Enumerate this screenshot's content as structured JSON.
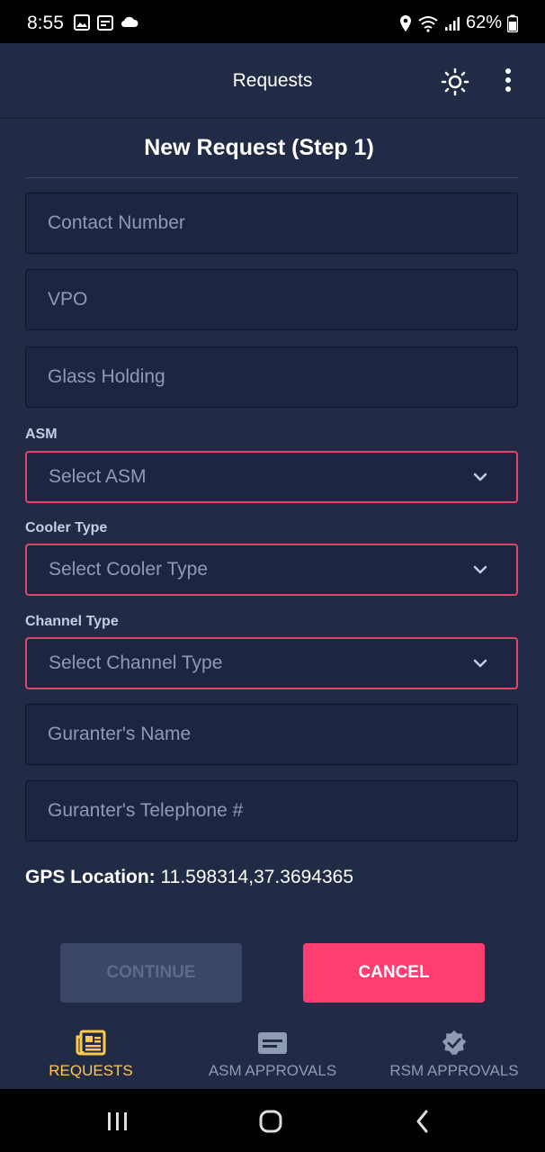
{
  "status_bar": {
    "time": "8:55",
    "battery": "62%"
  },
  "app_bar": {
    "title": "Requests",
    "theme_icon": "sun-icon",
    "menu_icon": "more-vertical-icon"
  },
  "page": {
    "title": "New Request (Step 1)"
  },
  "form": {
    "contact_number": {
      "placeholder": "Contact Number"
    },
    "vpo": {
      "placeholder": "VPO"
    },
    "glass_holding": {
      "placeholder": "Glass Holding"
    },
    "asm": {
      "label": "ASM",
      "value": "Select ASM"
    },
    "cooler_type": {
      "label": "Cooler Type",
      "value": "Select Cooler Type"
    },
    "channel_type": {
      "label": "Channel Type",
      "value": "Select Channel Type"
    },
    "guranter_name": {
      "placeholder": "Guranter's Name"
    },
    "guranter_phone": {
      "placeholder": "Guranter's Telephone #"
    },
    "gps": {
      "label": "GPS Location:",
      "value": "11.598314,37.3694365"
    }
  },
  "actions": {
    "continue": "CONTINUE",
    "cancel": "CANCEL"
  },
  "bottom_nav": [
    {
      "label": "REQUESTS",
      "icon": "newspaper-icon",
      "active": true
    },
    {
      "label": "ASM APPROVALS",
      "icon": "card-icon",
      "active": false
    },
    {
      "label": "RSM APPROVALS",
      "icon": "verified-badge-icon",
      "active": false
    }
  ],
  "colors": {
    "background": "#222b45",
    "field": "#1e2542",
    "accent": "#ff3d71",
    "active_nav": "#ffc94d",
    "disabled_button": "#3c4666"
  }
}
